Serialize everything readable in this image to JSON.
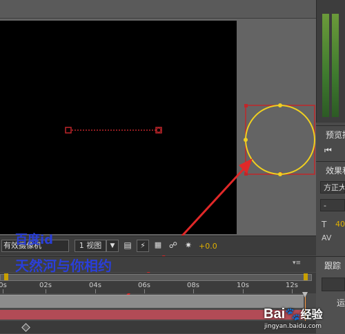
{
  "composition": {
    "toolbar": {
      "view_mode_label": "有效摄像机",
      "view_count_label": "1 视图",
      "exposure_value": "+0.0"
    }
  },
  "right_panels": {
    "preview_title": "预览控",
    "effects_title": "效果和",
    "font_field": "方正大",
    "dash_field": "-",
    "size_value": "40",
    "tracker_title": "跟踪",
    "tracker_sub": "运"
  },
  "timeline": {
    "ticks": [
      "0s",
      "02s",
      "04s",
      "06s",
      "08s",
      "10s",
      "12s"
    ]
  },
  "watermark": {
    "line1": "百度id",
    "line2": "天然河与你相约",
    "logo_text": "Bai",
    "logo_suffix": "经验",
    "url": "jingyan.baidu.com"
  },
  "colors": {
    "selection_red": "#c0262a",
    "circle_yellow": "#f0d020",
    "arrow_red": "#e02828",
    "watermark_blue": "#2a3fd8"
  }
}
